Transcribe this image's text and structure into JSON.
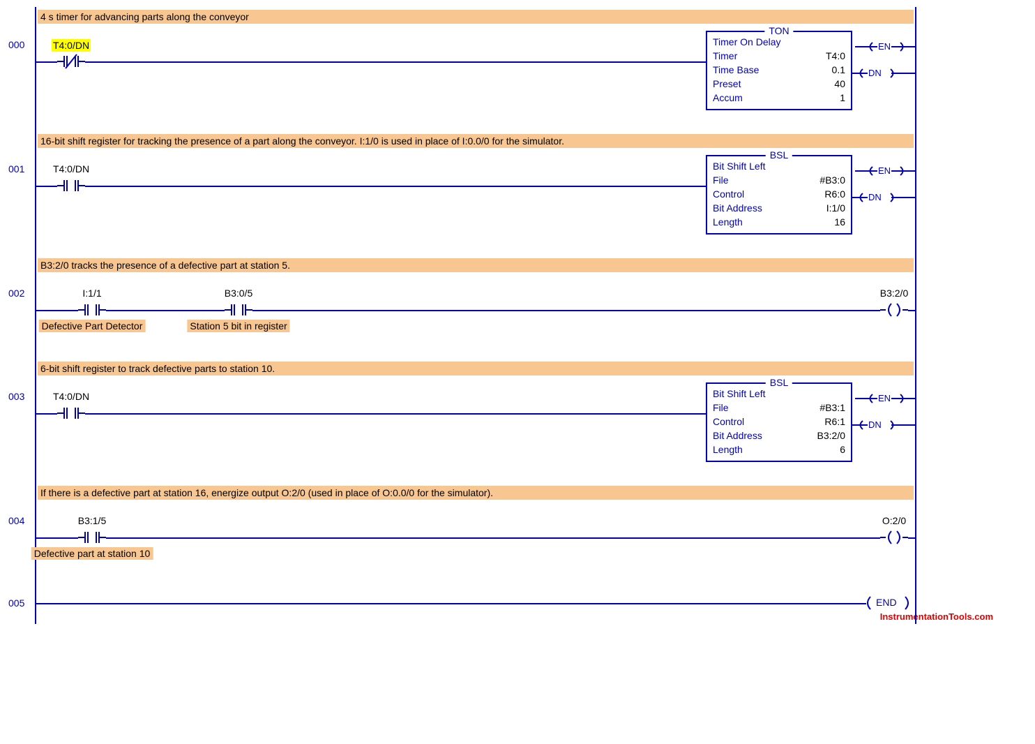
{
  "rungs": [
    {
      "num": "000",
      "comment": "4 s timer for advancing parts along the conveyor",
      "contact_label": "T4:0/DN",
      "contact_hl": true,
      "instr": {
        "mnemonic": "TON",
        "name": "Timer On Delay",
        "params": [
          {
            "k": "Timer",
            "v": "T4:0"
          },
          {
            "k": "Time Base",
            "v": "0.1"
          },
          {
            "k": "Preset",
            "v": "40"
          },
          {
            "k": "Accum",
            "v": "1"
          }
        ]
      }
    },
    {
      "num": "001",
      "comment": "16-bit shift register for tracking the presence of a part along the conveyor. I:1/0 is used in place of I:0.0/0 for the simulator.",
      "contact_label": "T4:0/DN",
      "instr": {
        "mnemonic": "BSL",
        "name": "Bit Shift Left",
        "params": [
          {
            "k": "File",
            "v": "#B3:0"
          },
          {
            "k": "Control",
            "v": "R6:0"
          },
          {
            "k": "Bit Address",
            "v": "I:1/0"
          },
          {
            "k": "Length",
            "v": "16"
          }
        ]
      }
    },
    {
      "num": "002",
      "comment": "B3:2/0 tracks the presence of a defective part at station 5.",
      "contacts2": [
        {
          "label": "I:1/1",
          "desc": "Defective Part Detector"
        },
        {
          "label": "B3:0/5",
          "desc": "Station 5 bit in register"
        }
      ],
      "coil_label": "B3:2/0"
    },
    {
      "num": "003",
      "comment": "6-bit shift register to track defective parts to station 10.",
      "contact_label": "T4:0/DN",
      "instr": {
        "mnemonic": "BSL",
        "name": "Bit Shift Left",
        "params": [
          {
            "k": "File",
            "v": "#B3:1"
          },
          {
            "k": "Control",
            "v": "R6:1"
          },
          {
            "k": "Bit Address",
            "v": "B3:2/0"
          },
          {
            "k": "Length",
            "v": "6"
          }
        ]
      }
    },
    {
      "num": "004",
      "comment": "If there is a defective part at station 16, energize output O:2/0 (used in place of O:0.0/0 for the simulator).",
      "contacts2": [
        {
          "label": "B3:1/5",
          "desc": "Defective part at station 10"
        }
      ],
      "coil_label": "O:2/0"
    },
    {
      "num": "005",
      "end_label": "END"
    }
  ],
  "side": {
    "en": "EN",
    "dn": "DN"
  },
  "watermark": "InstrumentationTools.com"
}
